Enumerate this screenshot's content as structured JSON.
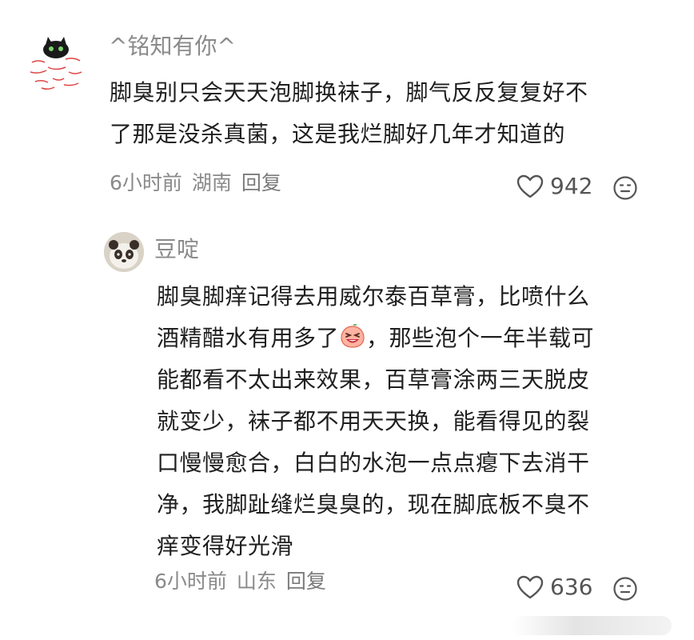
{
  "comments": [
    {
      "username": "^铭知有你^",
      "text_lines": [
        "脚臭别只会天天泡脚换袜子，脚气反反复复好不",
        "了那是没杀真菌，这是我烂脚好几年才知道的"
      ],
      "time": "6小时前",
      "location": "湖南",
      "reply_label": "回复",
      "like_count": "942"
    },
    {
      "username": "豆啶",
      "text_lines": [
        "脚臭脚痒记得去用威尔泰百草膏，比喷什么",
        "酒精醋水有用多了",
        "，那些泡个一年半载可",
        "能都看不太出来效果，百草膏涂两三天脱皮",
        "就变少，袜子都不用天天换，能看得见的裂",
        "口慢慢愈合，白白的水泡一点点瘪下去消干",
        "净，我脚趾缝烂臭臭的，现在脚底板不臭不",
        "痒变得好光滑"
      ],
      "time": "6小时前",
      "location": "山东",
      "reply_label": "回复",
      "like_count": "636"
    }
  ],
  "icons": {
    "like": "heart-outline-icon",
    "react": "neutral-face-icon",
    "inline_emoji": "laughing-peach-emoji"
  },
  "colors": {
    "username": "#8a8a8a",
    "text": "#1f1f1f",
    "meta": "#8a8a8a"
  }
}
